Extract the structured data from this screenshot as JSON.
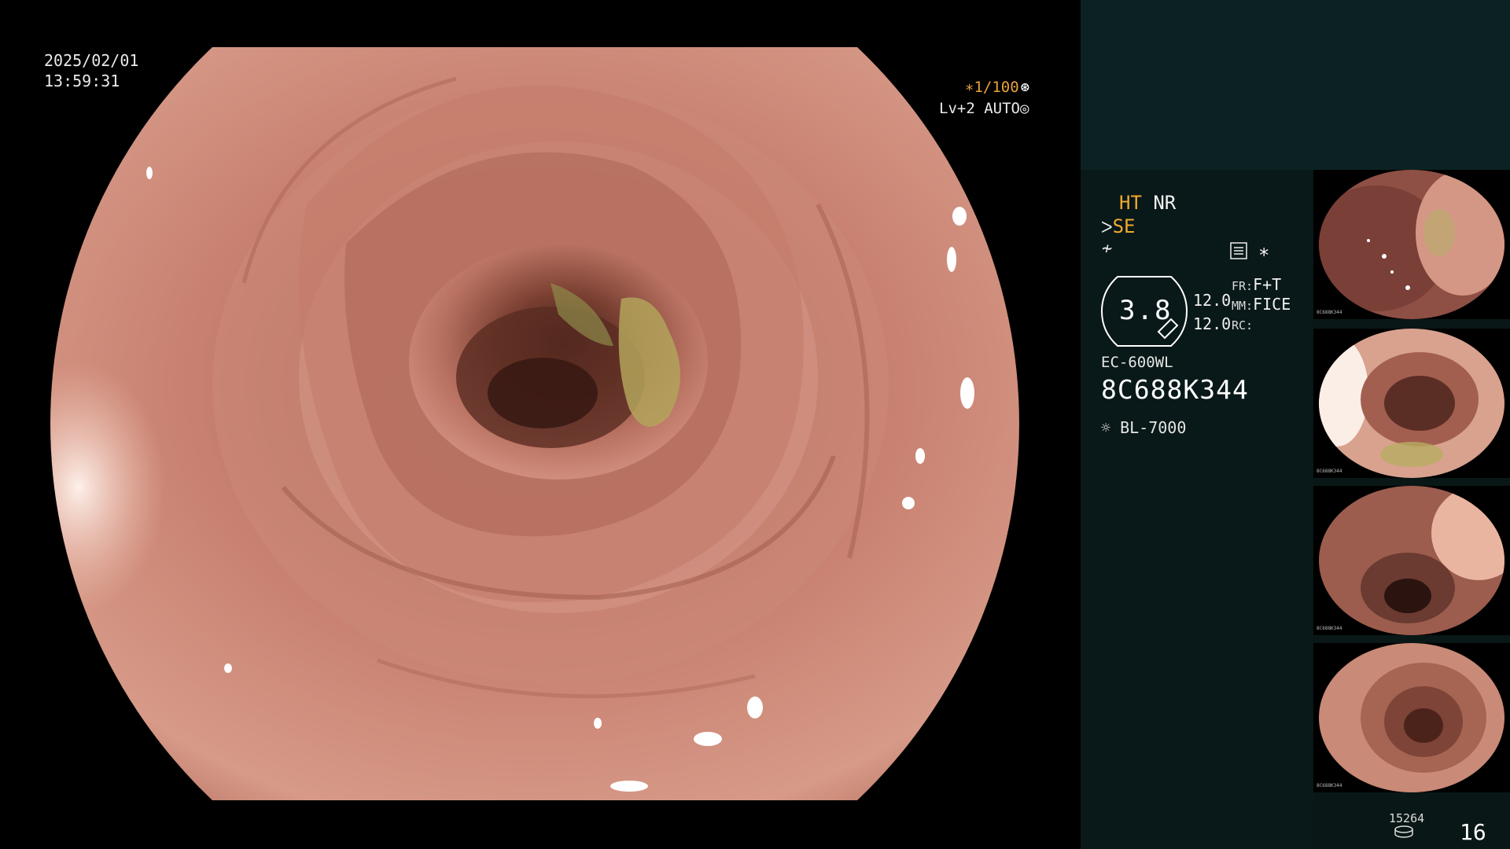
{
  "overlay": {
    "date": "2025/02/01",
    "time": "13:59:31",
    "shutter": "∗1/100",
    "level": "Lv+2 AUTO"
  },
  "panel": {
    "modes": {
      "ht": "HT",
      "nr": "NR",
      "se": "SE"
    },
    "asterisk": "∗",
    "gauge_value": "3.8",
    "left_values": [
      "12.0",
      "12.0"
    ],
    "settings": [
      {
        "key": "FR:",
        "value": "F+T"
      },
      {
        "key": "MM:",
        "value": "FICE"
      },
      {
        "key": "RC:",
        "value": ""
      }
    ],
    "scope_model": "EC-600WL",
    "scope_serial": "8C688K344",
    "light_source": "BL-7000"
  },
  "thumbnails": [
    {
      "serial": "8C688K344"
    },
    {
      "serial": "8C688K344"
    },
    {
      "serial": "8C688K344"
    },
    {
      "serial": "8C688K344"
    }
  ],
  "footer": {
    "image_count": "15264",
    "page": "16"
  },
  "colors": {
    "accent": "#f0a930",
    "panel_bg": "#091818",
    "top_panel_bg": "#0c2222",
    "tissue": "#c98574"
  }
}
